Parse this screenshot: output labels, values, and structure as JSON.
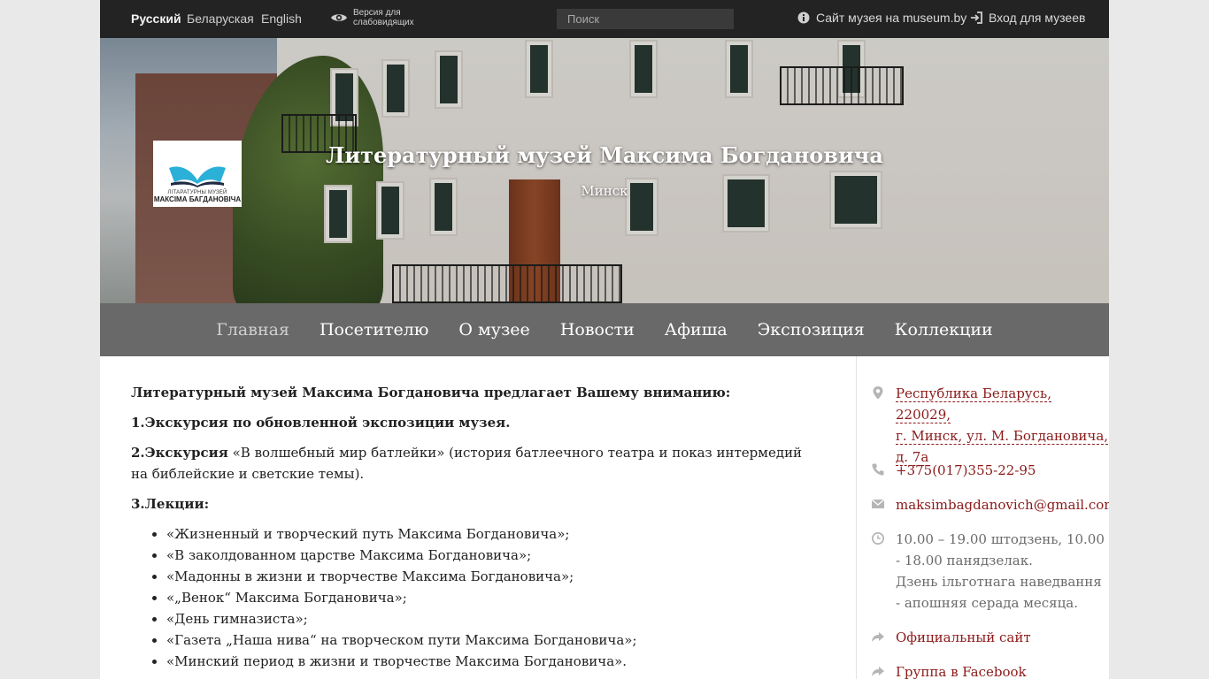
{
  "topbar": {
    "languages": [
      "Русский",
      "Беларуская",
      "English"
    ],
    "vision_label": "Версия для слабовидящих",
    "search_placeholder": "Поиск",
    "museum_site_link": "Сайт музея на museum.by",
    "login_link": "Вход для музеев"
  },
  "hero": {
    "logo_line1": "ЛІТАРАТУРНЫ МУЗЕЙ",
    "logo_line2": "МАКСІМА БАГДАНОВІЧА",
    "title": "Литературный музей Максима Богдановича",
    "city": "Минск"
  },
  "nav": {
    "items": [
      "Главная",
      "Посетителю",
      "О музее",
      "Новости",
      "Афиша",
      "Экспозиция",
      "Коллекции"
    ],
    "active": "Главная"
  },
  "content": {
    "intro": "Литературный музей Максима Богдановича предлагает Вашему вниманию:",
    "item1": "1.Экскурсия по обновленной экспозиции музея.",
    "item2_bold": "2.Экскурсия",
    "item2_rest": " «В волшебный мир батлейки» (история батлеечного театра и показ интермедий на библейские и светские темы).",
    "item3": "3.Лекции:",
    "lectures": [
      "«Жизненный и творческий путь Максима Богдановича»;",
      "«В заколдованном царстве Максима Богдановича»;",
      "«Мадонны в жизни и творчестве Максима Богдановича»;",
      "«„Венок“ Максима Богдановича»;",
      "«День гимназиста»;",
      "«Газета „Наша нива“ на творческом пути Максима Богдановича»;",
      "«Минский период в жизни и творчестве Максима Богдановича»."
    ]
  },
  "sidebar": {
    "address_lines": [
      "Республика Беларусь, 220029,",
      "г. Минск, ул. М. Богдановича,",
      "д. 7а"
    ],
    "phone": "+375(017)355-22-95",
    "email": "maksimbagdanovich@gmail.com",
    "hours_lines": [
      "10.00 – 19.00 штодзень, 10.00",
      "- 18.00 панядзелак.",
      "Дзень ільготнага наведвання",
      "- апошняя серада месяца."
    ],
    "official_site": "Официальный сайт",
    "facebook": "Группа в Facebook"
  },
  "colors": {
    "topbar_bg": "#232323",
    "nav_bg": "#696969",
    "link": "#8b1a1a"
  }
}
